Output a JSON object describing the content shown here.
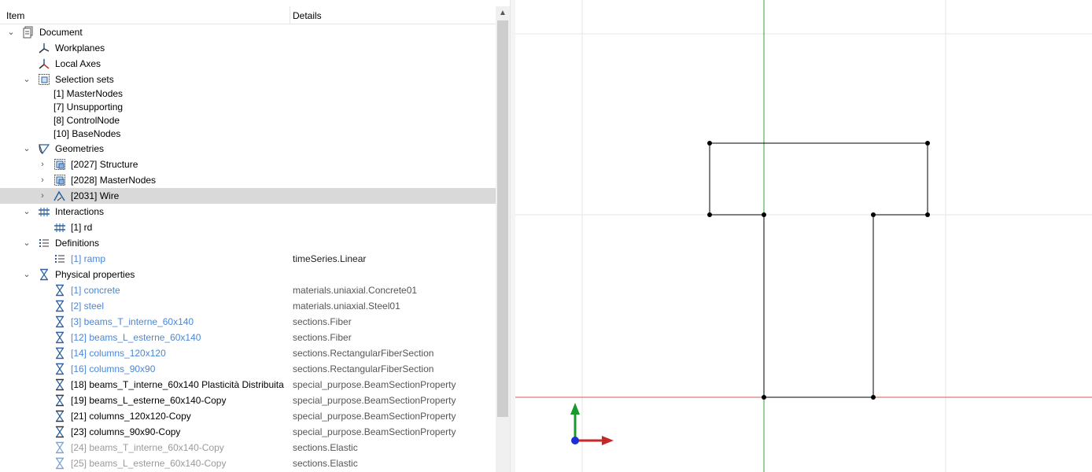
{
  "tree": {
    "header": {
      "item": "Item",
      "details": "Details"
    },
    "document": {
      "label": "Document"
    },
    "workplanes": {
      "label": "Workplanes"
    },
    "local_axes": {
      "label": "Local Axes"
    },
    "selection_sets": {
      "label": "Selection sets",
      "items": [
        "[1] MasterNodes",
        "[7] Unsupporting",
        "[8] ControlNode",
        "[10] BaseNodes"
      ]
    },
    "geometries": {
      "label": "Geometries",
      "items": [
        "[2027] Structure",
        "[2028] MasterNodes",
        "[2031] Wire"
      ]
    },
    "interactions": {
      "label": "Interactions",
      "items": [
        "[1] rd"
      ]
    },
    "definitions": {
      "label": "Definitions",
      "items": [
        {
          "label": "[1] ramp",
          "details": "timeSeries.Linear"
        }
      ]
    },
    "physical_properties": {
      "label": "Physical properties",
      "items": [
        {
          "label": "[1] concrete",
          "details": "materials.uniaxial.Concrete01"
        },
        {
          "label": "[2] steel",
          "details": "materials.uniaxial.Steel01"
        },
        {
          "label": "[3] beams_T_interne_60x140",
          "details": "sections.Fiber"
        },
        {
          "label": "[12] beams_L_esterne_60x140",
          "details": "sections.Fiber"
        },
        {
          "label": "[14] columns_120x120",
          "details": "sections.RectangularFiberSection"
        },
        {
          "label": "[16] columns_90x90",
          "details": "sections.RectangularFiberSection"
        },
        {
          "label": "[18] beams_T_interne_60x140 Plasticità Distribuita",
          "details": "special_purpose.BeamSectionProperty"
        },
        {
          "label": "[19] beams_L_esterne_60x140-Copy",
          "details": "special_purpose.BeamSectionProperty"
        },
        {
          "label": "[21] columns_120x120-Copy",
          "details": "special_purpose.BeamSectionProperty"
        },
        {
          "label": "[23] columns_90x90-Copy",
          "details": "special_purpose.BeamSectionProperty"
        },
        {
          "label": "[24] beams_T_interne_60x140-Copy",
          "details": "sections.Elastic"
        },
        {
          "label": "[25] beams_L_esterne_60x140-Copy",
          "details": "sections.Elastic"
        }
      ]
    }
  },
  "colors": {
    "accent_link": "#4a86d6",
    "x_axis": "#d9534f",
    "y_axis": "#2ca02c",
    "selection": "#d9d9d9"
  },
  "icons": {
    "document": "document-icon",
    "workplanes": "workplanes-icon",
    "local_axes": "local-axes-icon",
    "selection_sets": "selection-set-icon",
    "geometries": "geometry-icon",
    "interactions": "interaction-icon",
    "definitions": "definition-list-icon",
    "physical_properties": "physical-property-icon"
  }
}
